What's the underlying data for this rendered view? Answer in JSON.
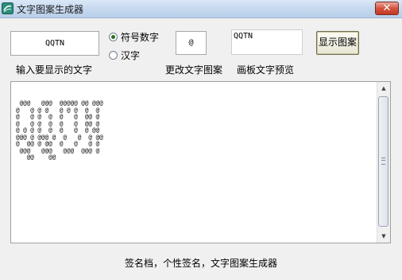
{
  "window": {
    "title": "文字图案生成器",
    "close_label": "✕"
  },
  "controls": {
    "text_input_value": "QQTN",
    "text_input_label": "输入要显示的文字",
    "radio_symbol_label": "符号数字",
    "radio_hanzi_label": "汉字",
    "selected_mode": "符号数字",
    "pattern_char_value": "@",
    "pattern_char_label": "更改文字图案",
    "preview_value": "QQTN",
    "preview_label": "画板文字预览",
    "show_button_label": "显示图案"
  },
  "art": {
    "text": " @@@   @@@  @@@@@ @@ @@@\n@   @ @ @   @ @ @  @  @\n@   @ @  @  @   @  @@ @\n@   @ @  @  @   @  @@ @\n@ @ @ @  @  @   @  @ @@\n@@@ @ @@@ @  @   @  @ @@\n@  @@ @ @@  @   @   @ @\n @@@   @@@   @@@  @@@ @\n   @@    @@"
  },
  "footer": {
    "text": "签名档，个性签名，文字图案生成器"
  },
  "colors": {
    "accent": "#2c6e1e",
    "close": "#d4533f",
    "titlebar": "#c4d7ee"
  }
}
